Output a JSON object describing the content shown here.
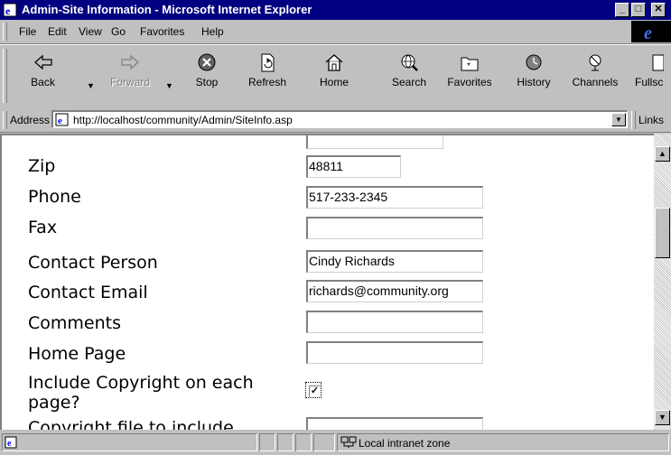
{
  "window": {
    "title": "Admin-Site Information - Microsoft Internet Explorer"
  },
  "menu": {
    "items": [
      {
        "label": "File"
      },
      {
        "label": "Edit"
      },
      {
        "label": "View"
      },
      {
        "label": "Go"
      },
      {
        "label": "Favorites"
      },
      {
        "label": "Help"
      }
    ]
  },
  "toolbar": {
    "back": "Back",
    "forward": "Forward",
    "stop": "Stop",
    "refresh": "Refresh",
    "home": "Home",
    "search": "Search",
    "favorites": "Favorites",
    "history": "History",
    "channels": "Channels",
    "fullscreen": "Fullsc"
  },
  "address": {
    "label": "Address",
    "url": "http://localhost/community/Admin/SiteInfo.asp",
    "links": "Links"
  },
  "form": {
    "zip_label": "Zip",
    "zip_value": "48811",
    "phone_label": "Phone",
    "phone_value": "517-233-2345",
    "fax_label": "Fax",
    "fax_value": "",
    "contact_person_label": "Contact Person",
    "contact_person_value": "Cindy Richards",
    "contact_email_label": "Contact Email",
    "contact_email_value": "richards@community.org",
    "comments_label": "Comments",
    "comments_value": "",
    "home_page_label": "Home Page",
    "home_page_value": "",
    "copyright_label_line1": "Include Copyright on each",
    "copyright_label_line2": "page?",
    "copyright_checked": true,
    "copyright_file_label": "Copyright file to include"
  },
  "status": {
    "zone": "Local intranet zone"
  },
  "colors": {
    "titlebar": "#000080",
    "chrome": "#c0c0c0"
  }
}
